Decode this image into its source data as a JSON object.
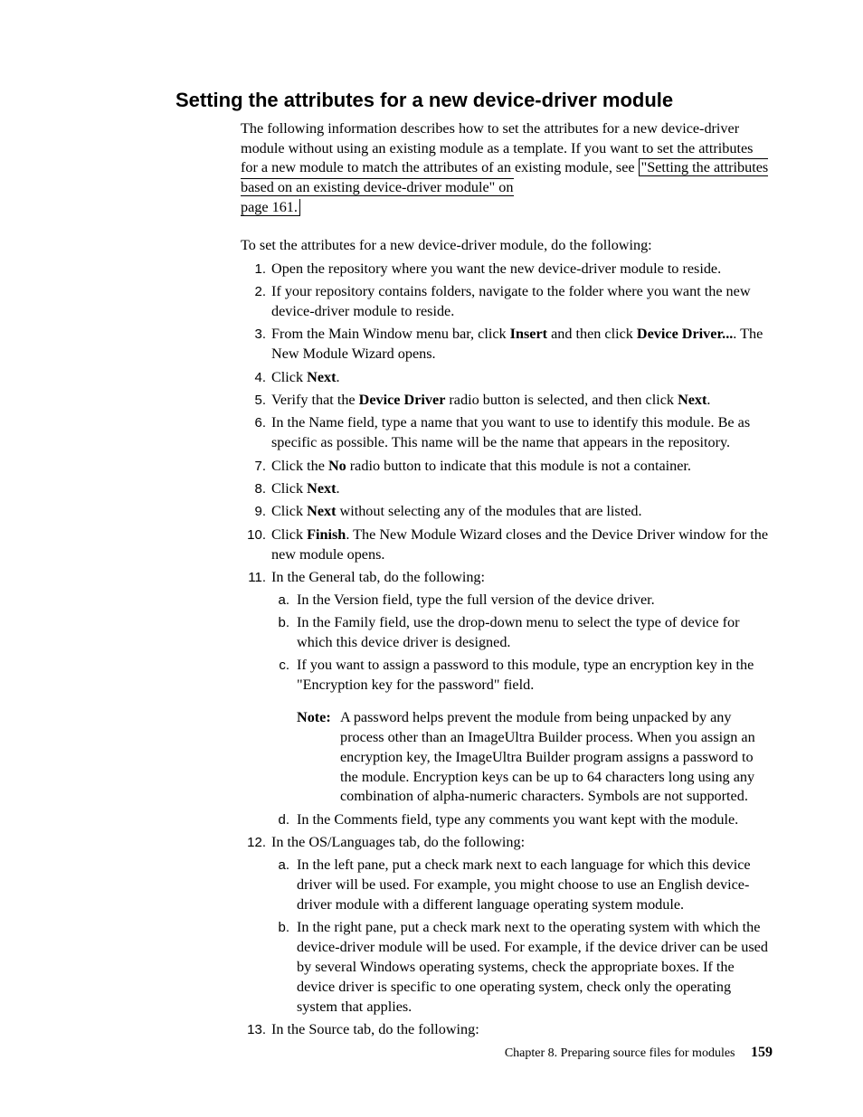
{
  "heading": "Setting the attributes for a new device-driver module",
  "intro": {
    "part1": "The following information describes how to set the attributes for a new device-driver module without using an existing module as a template. If you want to set the attributes for a new module to match the attributes of an existing module, see ",
    "link1": "\"Setting the attributes based on an existing device-driver module\" on",
    "link2": "page 161."
  },
  "lead": "To set the attributes for a new device-driver module, do the following:",
  "steps": [
    {
      "n": "1.",
      "t1": "Open the repository where you want the new device-driver module to reside."
    },
    {
      "n": "2.",
      "t1": "If your repository contains folders, navigate to the folder where you want the new device-driver module to reside."
    },
    {
      "n": "3.",
      "t1": "From the Main Window menu bar, click ",
      "b1": "Insert",
      "t2": " and then click ",
      "b2": "Device Driver...",
      "t3": ". The New Module Wizard opens."
    },
    {
      "n": "4.",
      "t1": "Click ",
      "b1": "Next",
      "t2": "."
    },
    {
      "n": "5.",
      "t1": "Verify that the ",
      "b1": "Device Driver",
      "t2": " radio button is selected, and then click ",
      "b2": "Next",
      "t3": "."
    },
    {
      "n": "6.",
      "t1": "In the Name field, type a name that you want to use to identify this module. Be as specific as possible. This name will be the name that appears in the repository."
    },
    {
      "n": "7.",
      "t1": "Click the ",
      "b1": "No",
      "t2": " radio button to indicate that this module is not a container."
    },
    {
      "n": "8.",
      "t1": "Click ",
      "b1": "Next",
      "t2": "."
    },
    {
      "n": "9.",
      "t1": "Click ",
      "b1": "Next",
      "t2": " without selecting any of the modules that are listed."
    },
    {
      "n": "10.",
      "t1": "Click ",
      "b1": "Finish",
      "t2": ". The New Module Wizard closes and the Device Driver window for the new module opens."
    },
    {
      "n": "11.",
      "t1": "In the General tab, do the following:",
      "sub": [
        {
          "l": "a.",
          "t1": "In the Version field, type the full version of the device driver."
        },
        {
          "l": "b.",
          "t1": "In the Family field, use the drop-down menu to select the type of device for which this device driver is designed."
        },
        {
          "l": "c.",
          "t1": "If you want to assign a password to this module, type an encryption key in the \"Encryption key for the password\" field.",
          "note_label": "Note:",
          "note": "A password helps prevent the module from being unpacked by any process other than an ImageUltra Builder process. When you assign an encryption key, the ImageUltra Builder program assigns a password to the module. Encryption keys can be up to 64 characters long using any combination of alpha-numeric characters. Symbols are not supported."
        },
        {
          "l": "d.",
          "t1": "In the Comments field, type any comments you want kept with the module."
        }
      ]
    },
    {
      "n": "12.",
      "t1": "In the OS/Languages tab, do the following:",
      "sub": [
        {
          "l": "a.",
          "t1": "In the left pane, put a check mark next to each language for which this device driver will be used. For example, you might choose to use an English device-driver module with a different language operating system module."
        },
        {
          "l": "b.",
          "t1": "In the right pane, put a check mark next to the operating system with which the device-driver module will be used. For example, if the device driver can be used by several Windows operating systems, check the appropriate boxes. If the device driver is specific to one operating system, check only the operating system that applies."
        }
      ]
    },
    {
      "n": "13.",
      "t1": "In the Source tab, do the following:"
    }
  ],
  "footer": {
    "chapter": "Chapter 8. Preparing source files for modules",
    "page": "159"
  }
}
